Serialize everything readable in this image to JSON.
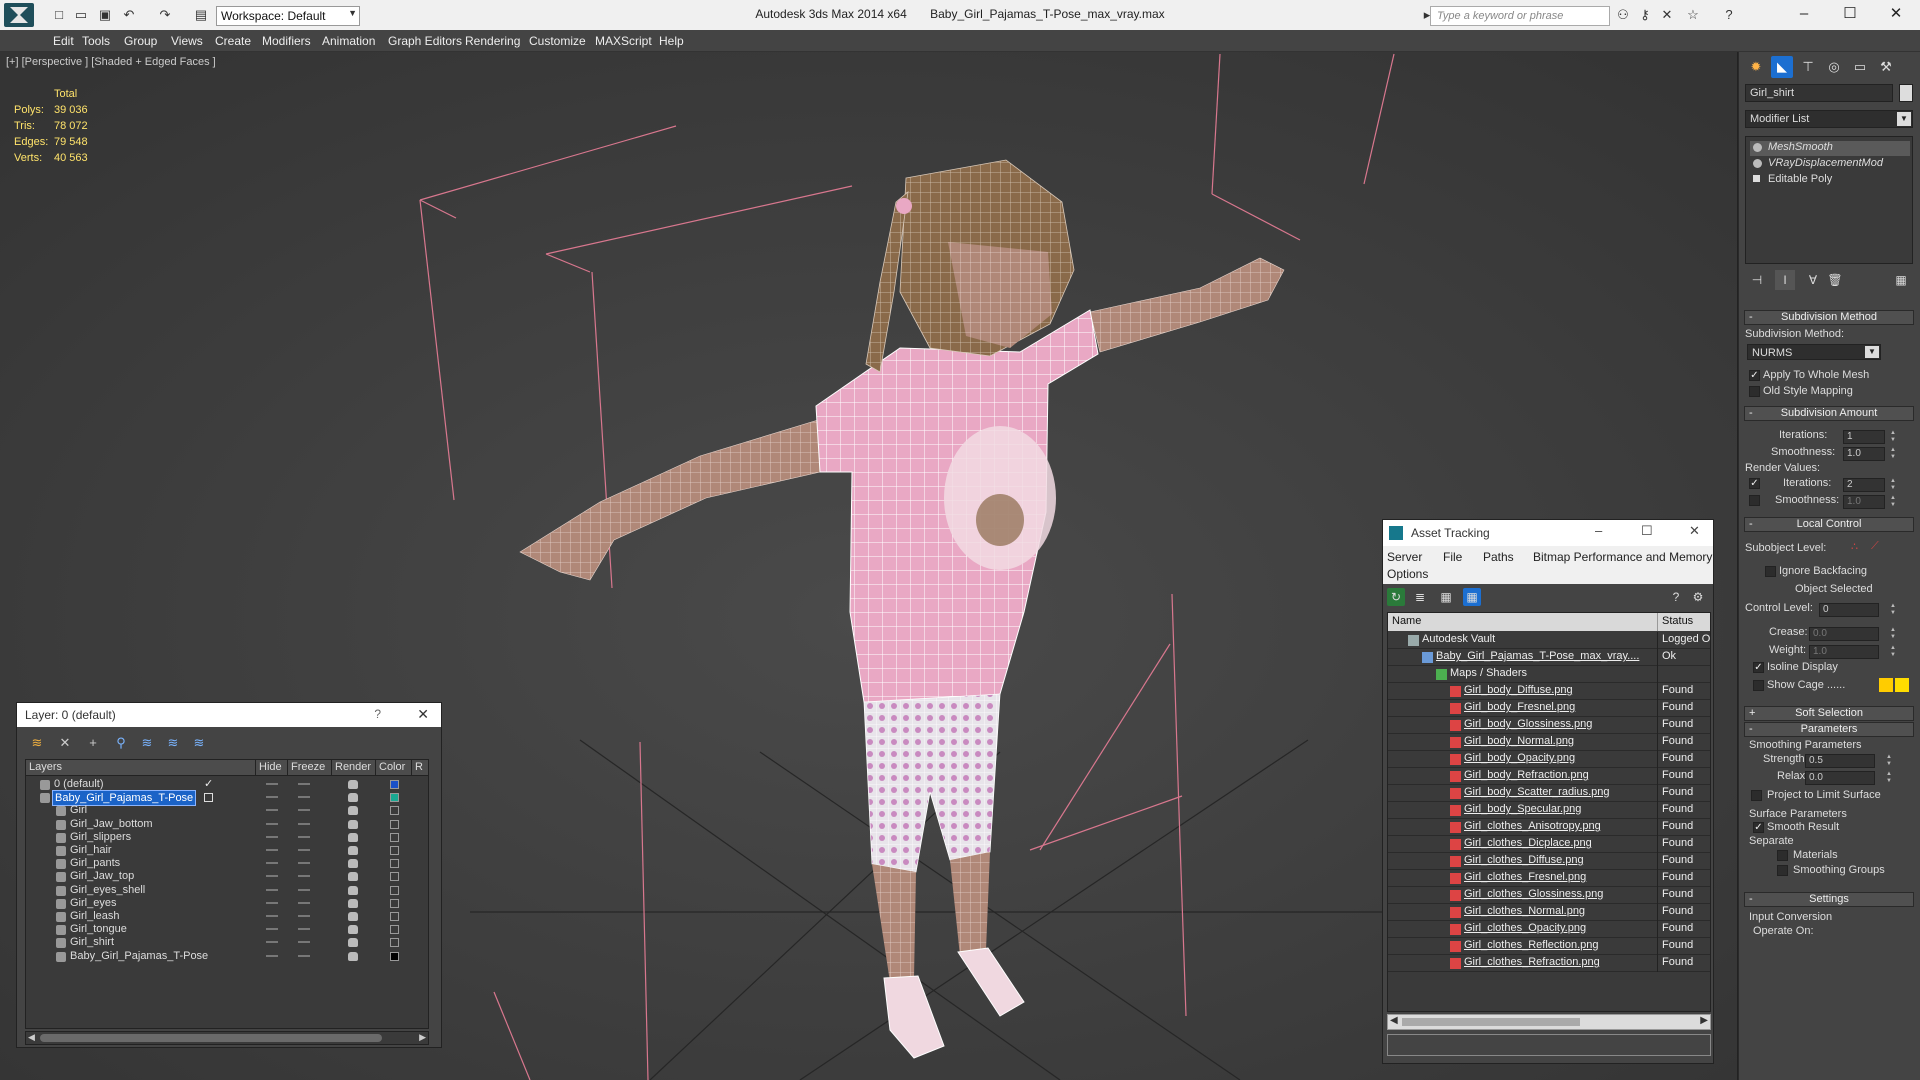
{
  "window": {
    "app_title": "Autodesk 3ds Max  2014 x64",
    "file_title": "Baby_Girl_Pajamas_T-Pose_max_vray.max",
    "workspace": "Workspace: Default",
    "search_placeholder": "Type a keyword or phrase"
  },
  "menu": [
    "Edit",
    "Tools",
    "Group",
    "Views",
    "Create",
    "Modifiers",
    "Animation",
    "Graph Editors",
    "Rendering",
    "Customize",
    "MAXScript",
    "Help"
  ],
  "viewport": {
    "label": "[+] [Perspective ] [Shaded + Edged Faces ]",
    "stats_header": "Total",
    "stats": [
      {
        "k": "Polys:",
        "v": "39 036"
      },
      {
        "k": "Tris:",
        "v": "78 072"
      },
      {
        "k": "Edges:",
        "v": "79 548"
      },
      {
        "k": "Verts:",
        "v": "40 563"
      }
    ]
  },
  "command_panel": {
    "object_name": "Girl_shirt",
    "modifier_list": "Modifier List",
    "stack": [
      "MeshSmooth",
      "VRayDisplacementMod",
      "Editable Poly"
    ],
    "subdivision_method_title": "Subdivision Method",
    "subdivision_method_label": "Subdivision Method:",
    "subdivision_method_value": "NURMS",
    "apply_whole_mesh": "Apply To Whole Mesh",
    "old_style_mapping": "Old Style Mapping",
    "subdivision_amount_title": "Subdivision Amount",
    "iterations_label": "Iterations:",
    "iterations_value": "1",
    "smoothness_label": "Smoothness:",
    "smoothness_value": "1.0",
    "render_values_label": "Render Values:",
    "render_iterations_value": "2",
    "render_smoothness_value": "1.0",
    "local_control_title": "Local Control",
    "subobject_level_label": "Subobject Level:",
    "ignore_backfacing": "Ignore Backfacing",
    "object_selected": "Object Selected",
    "control_level_label": "Control Level:",
    "control_level_value": "0",
    "crease_label": "Crease:",
    "crease_value": "0.0",
    "weight_label": "Weight:",
    "weight_value": "1.0",
    "isoline_display": "Isoline Display",
    "show_cage": "Show Cage ......",
    "cage_colors": [
      "#ffcc00",
      "#ffdd00"
    ],
    "soft_selection_title": "Soft Selection",
    "parameters_title": "Parameters",
    "smoothing_parameters": "Smoothing Parameters",
    "strength_label": "Strength:",
    "strength_value": "0.5",
    "relax_label": "Relax:",
    "relax_value": "0.0",
    "project_limit_surface": "Project to Limit Surface",
    "surface_parameters": "Surface Parameters",
    "smooth_result": "Smooth Result",
    "separate_label": "Separate",
    "materials": "Materials",
    "smoothing_groups": "Smoothing Groups",
    "settings_title": "Settings",
    "input_conversion": "Input Conversion",
    "operate_on": "Operate On:"
  },
  "layer_dialog": {
    "title": "Layer: 0 (default)",
    "help": "?",
    "columns": [
      "Layers",
      "Hide",
      "Freeze",
      "Render",
      "Color",
      "R"
    ],
    "rows": [
      {
        "name": "0 (default)",
        "color": "#1a50c8",
        "level": 0,
        "checked": true
      },
      {
        "name": "Baby_Girl_Pajamas_T-Pose",
        "color": "#1aa892",
        "level": 0,
        "selected": true
      },
      {
        "name": "Girl",
        "color": "#3a3a3a",
        "level": 1
      },
      {
        "name": "Girl_Jaw_bottom",
        "color": "#3a3a3a",
        "level": 1
      },
      {
        "name": "Girl_slippers",
        "color": "#3a3a3a",
        "level": 1
      },
      {
        "name": "Girl_hair",
        "color": "#3a3a3a",
        "level": 1
      },
      {
        "name": "Girl_pants",
        "color": "#3a3a3a",
        "level": 1
      },
      {
        "name": "Girl_Jaw_top",
        "color": "#3a3a3a",
        "level": 1
      },
      {
        "name": "Girl_eyes_shell",
        "color": "#3a3a3a",
        "level": 1
      },
      {
        "name": "Girl_eyes",
        "color": "#3a3a3a",
        "level": 1
      },
      {
        "name": "Girl_leash",
        "color": "#3a3a3a",
        "level": 1
      },
      {
        "name": "Girl_tongue",
        "color": "#3a3a3a",
        "level": 1
      },
      {
        "name": "Girl_shirt",
        "color": "#3a3a3a",
        "level": 1
      },
      {
        "name": "Baby_Girl_Pajamas_T-Pose",
        "color": "#000000",
        "level": 1
      }
    ]
  },
  "asset_dialog": {
    "title": "Asset Tracking",
    "menu": [
      "Server",
      "File",
      "Paths",
      "Bitmap Performance and Memory",
      "Options"
    ],
    "columns": [
      "Name",
      "Status"
    ],
    "rows": [
      {
        "name": "Autodesk Vault",
        "status": "Logged O",
        "level": 0,
        "type": "vault"
      },
      {
        "name": "Baby_Girl_Pajamas_T-Pose_max_vray....",
        "status": "Ok",
        "level": 1,
        "type": "max"
      },
      {
        "name": "Maps / Shaders",
        "status": "",
        "level": 2,
        "type": "maps"
      },
      {
        "name": "Girl_body_Diffuse.png",
        "status": "Found",
        "level": 3,
        "type": "png"
      },
      {
        "name": "Girl_body_Fresnel.png",
        "status": "Found",
        "level": 3,
        "type": "png"
      },
      {
        "name": "Girl_body_Glossiness.png",
        "status": "Found",
        "level": 3,
        "type": "png"
      },
      {
        "name": "Girl_body_Normal.png",
        "status": "Found",
        "level": 3,
        "type": "png"
      },
      {
        "name": "Girl_body_Opacity.png",
        "status": "Found",
        "level": 3,
        "type": "png"
      },
      {
        "name": "Girl_body_Refraction.png",
        "status": "Found",
        "level": 3,
        "type": "png"
      },
      {
        "name": "Girl_body_Scatter_radius.png",
        "status": "Found",
        "level": 3,
        "type": "png"
      },
      {
        "name": "Girl_body_Specular.png",
        "status": "Found",
        "level": 3,
        "type": "png"
      },
      {
        "name": "Girl_clothes_Anisotropy.png",
        "status": "Found",
        "level": 3,
        "type": "png"
      },
      {
        "name": "Girl_clothes_Dicplace.png",
        "status": "Found",
        "level": 3,
        "type": "png"
      },
      {
        "name": "Girl_clothes_Diffuse.png",
        "status": "Found",
        "level": 3,
        "type": "png"
      },
      {
        "name": "Girl_clothes_Fresnel.png",
        "status": "Found",
        "level": 3,
        "type": "png"
      },
      {
        "name": "Girl_clothes_Glossiness.png",
        "status": "Found",
        "level": 3,
        "type": "png"
      },
      {
        "name": "Girl_clothes_Normal.png",
        "status": "Found",
        "level": 3,
        "type": "png"
      },
      {
        "name": "Girl_clothes_Opacity.png",
        "status": "Found",
        "level": 3,
        "type": "png"
      },
      {
        "name": "Girl_clothes_Reflection.png",
        "status": "Found",
        "level": 3,
        "type": "png"
      },
      {
        "name": "Girl_clothes_Refraction.png",
        "status": "Found",
        "level": 3,
        "type": "png"
      }
    ]
  }
}
